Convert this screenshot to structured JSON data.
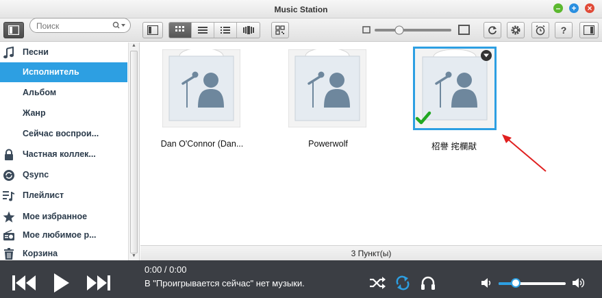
{
  "window": {
    "title": "Music Station"
  },
  "search": {
    "placeholder": "Поиск"
  },
  "sidebar": {
    "items": [
      {
        "label": "Песни",
        "icon": "music-note-icon"
      },
      {
        "label": "Исполнитель",
        "icon": "artist-icon",
        "active": true
      },
      {
        "label": "Альбом",
        "icon": "album-icon"
      },
      {
        "label": "Жанр",
        "icon": "genre-icon"
      },
      {
        "label": "Сейчас воспрои...",
        "icon": "now-playing-icon"
      },
      {
        "label": "Частная коллек...",
        "icon": "lock-icon"
      },
      {
        "label": "Qsync",
        "icon": "qsync-icon"
      },
      {
        "label": "Плейлист",
        "icon": "playlist-icon"
      },
      {
        "label": "Мое избранное",
        "icon": "star-icon"
      },
      {
        "label": "Мое любимое р...",
        "icon": "radio-icon"
      },
      {
        "label": "Корзина",
        "icon": "trash-icon"
      }
    ]
  },
  "artists": [
    {
      "name": "Dan O'Connor (Dan...",
      "selected": false
    },
    {
      "name": "Powerwolf",
      "selected": false
    },
    {
      "name": "柖譽 挓欄猒",
      "selected": true
    }
  ],
  "status": {
    "count_text": "3 Пункт(ы)"
  },
  "player": {
    "time": "0:00 / 0:00",
    "message": "В \"Проигрывается сейчас\" нет музыки.",
    "volume_fraction": 0.25
  },
  "colors": {
    "accent": "#2d9fe2",
    "check": "#22a822",
    "arrow": "#e02020"
  }
}
